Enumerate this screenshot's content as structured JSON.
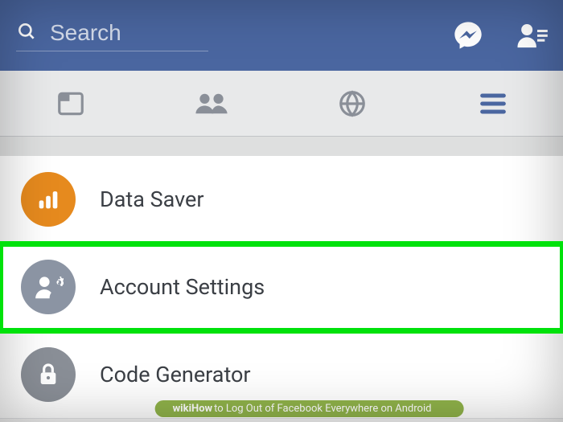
{
  "header": {
    "search_placeholder": "Search"
  },
  "menu": {
    "items": [
      {
        "label": "Data Saver"
      },
      {
        "label": "Account Settings"
      },
      {
        "label": "Code Generator"
      }
    ]
  },
  "caption": {
    "brand1": "wiki",
    "brand2": "How",
    "rest": " to Log Out of Facebook Everywhere on Android"
  },
  "colors": {
    "header_bg": "#4a66a0",
    "highlight": "#00e20b",
    "icon_orange": "#e68a1e",
    "icon_gray": "#8b94a3"
  }
}
